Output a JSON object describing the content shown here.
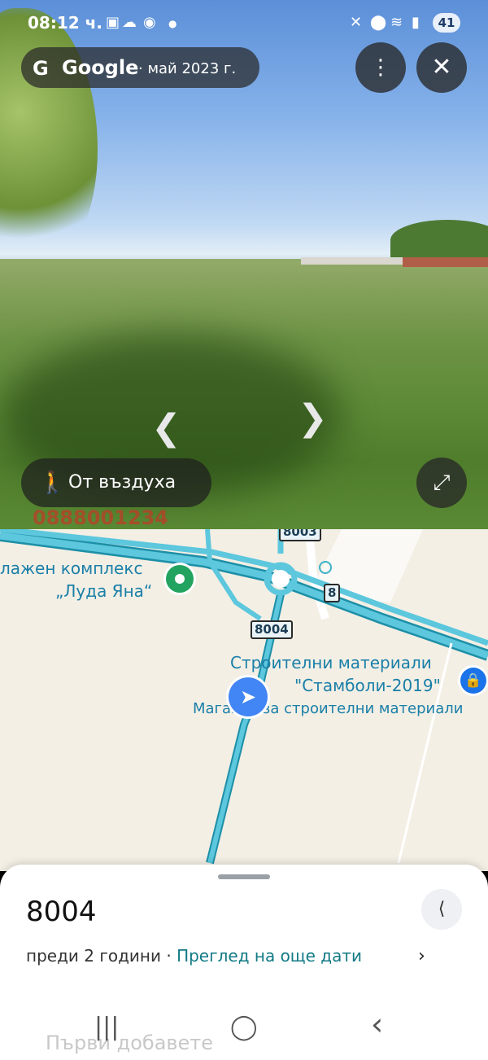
{
  "status": {
    "time": "08:12 ч.",
    "battery": "41"
  },
  "header": {
    "logo": "G",
    "brand": "Google",
    "capture_date": "· май 2023 г."
  },
  "controls": {
    "more": "⋮",
    "close": "✕",
    "arrow_left": "❮",
    "arrow_right": "❯",
    "aerial_label": "От въздуха",
    "expand": "⤢"
  },
  "watermark": "0888001234",
  "map": {
    "poi_resort_line1": "лажен комплекс",
    "poi_resort_line2": "„Луда Яна“",
    "poi_store_line1": "Строителни материали",
    "poi_store_line2": "\"Стамболи-2019\"",
    "poi_shop": "Магазин за строителни материали",
    "shield_8003": "8003",
    "shield_8": "8",
    "shield_8004": "8004"
  },
  "sheet": {
    "title": "8004",
    "age": "преди 2 години · ",
    "more_dates": "Преглед на още дати",
    "chevron": "›",
    "ghost_text": "Първи добавете"
  },
  "navbar": {
    "recents": "|||",
    "home": "◯",
    "back": "‹"
  },
  "colors": {
    "road": "#3bb0c9",
    "resort_pin": "#22a35f",
    "store_pin": "#1a73e8",
    "user_pin": "#4285f4",
    "link": "#127a85"
  }
}
